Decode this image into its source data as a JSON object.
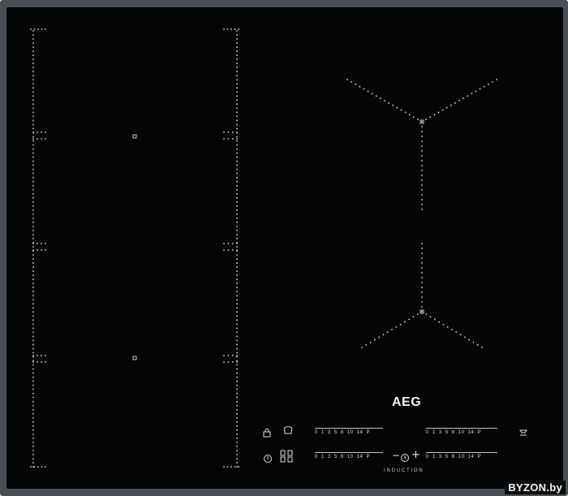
{
  "brand": {
    "logo": "AEG",
    "technology_label": "INDUCTION"
  },
  "controls": {
    "lock_icon": "lock-icon",
    "chef_hat_icon": "chef-hat-icon",
    "power_icon": "power-icon",
    "bridge_icon": "bridge-zone-icon",
    "hob2hood_icon": "hob2hood-icon",
    "timer_minus": "−",
    "timer_plus": "+",
    "scale_numbers": [
      "0",
      "1",
      "3",
      "5",
      "8",
      "10",
      "14",
      "P"
    ]
  },
  "watermark": {
    "text": "BYZON.by"
  }
}
